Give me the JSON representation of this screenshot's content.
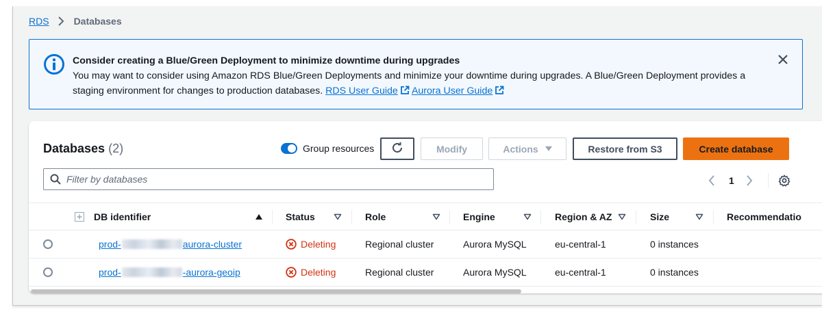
{
  "breadcrumb": {
    "root": "RDS",
    "current": "Databases"
  },
  "alert": {
    "title": "Consider creating a Blue/Green Deployment to minimize downtime during upgrades",
    "body_line1": "You may want to consider using Amazon RDS Blue/Green Deployments and minimize your downtime during upgrades. A Blue/Green Deployment provides a",
    "body_line2": "staging environment for changes to production databases.",
    "link1": "RDS User Guide",
    "link2": "Aurora User Guide",
    "icon": "info-icon"
  },
  "panel": {
    "title": "Databases",
    "count": "(2)",
    "group_toggle_label": "Group resources",
    "group_toggle_on": true,
    "buttons": {
      "modify": "Modify",
      "actions": "Actions",
      "restore": "Restore from S3",
      "create": "Create database"
    },
    "filter_placeholder": "Filter by databases",
    "page": "1"
  },
  "table": {
    "headers": {
      "db_identifier": "DB identifier",
      "status": "Status",
      "role": "Role",
      "engine": "Engine",
      "region": "Region & AZ",
      "size": "Size",
      "recommendations": "Recommendatio"
    },
    "rows": [
      {
        "id_prefix": "prod-",
        "id_suffix": "aurora-cluster",
        "status": "Deleting",
        "role": "Regional cluster",
        "engine": "Aurora MySQL",
        "region": "eu-central-1",
        "size": "0 instances"
      },
      {
        "id_prefix": "prod-",
        "id_suffix": "-aurora-geoip",
        "status": "Deleting",
        "role": "Regional cluster",
        "engine": "Aurora MySQL",
        "region": "eu-central-1",
        "size": "0 instances"
      }
    ]
  },
  "colors": {
    "link": "#0972d3",
    "primary": "#ec7211",
    "deleting": "#d13212",
    "info_bg": "#f2f8fd"
  }
}
